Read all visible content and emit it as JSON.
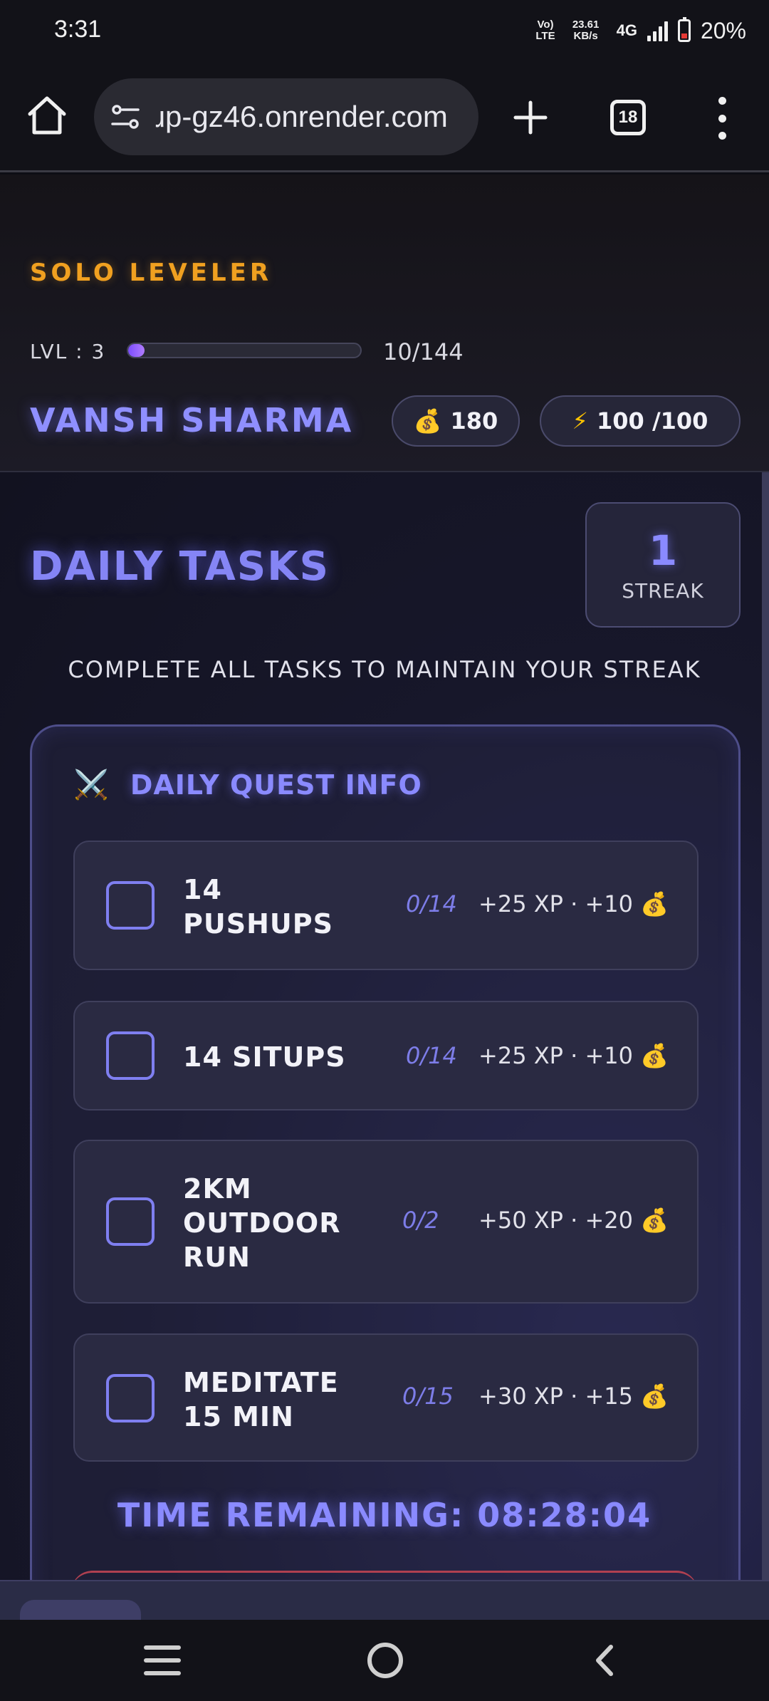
{
  "status_bar": {
    "time": "3:31",
    "volte": "Vo) LTE",
    "speed": "23.61 KB/s",
    "network": "4G",
    "battery": "20%"
  },
  "browser": {
    "url": "ɹp-gz46.onrender.com",
    "tab_count": "18"
  },
  "header": {
    "brand": "SOLO LEVELER",
    "level_label": "LVL : 3",
    "xp_text": "10/144",
    "xp_fraction": 0.07,
    "player_name": "VANSH SHARMA",
    "gold_icon": "💰",
    "gold": "180",
    "energy_icon": "⚡",
    "energy": "100 /100"
  },
  "daily": {
    "title": "DAILY TASKS",
    "streak_value": "1",
    "streak_label": "STREAK",
    "hint": "COMPLETE ALL TASKS TO MAINTAIN YOUR STREAK",
    "panel_icon": "⚔️",
    "panel_title": "DAILY QUEST INFO",
    "tasks": [
      {
        "name": "14 PUSHUPS",
        "progress": "0/14",
        "reward": "+25 XP · +10 💰"
      },
      {
        "name": "14 SITUPS",
        "progress": "0/14",
        "reward": "+25 XP · +10 💰"
      },
      {
        "name": "2KM OUTDOOR RUN",
        "progress": "0/2",
        "reward": "+50 XP · +20 💰"
      },
      {
        "name": "MEDITATE 15 MIN",
        "progress": "0/15",
        "reward": "+30 XP · +15 💰"
      }
    ],
    "timer": "TIME REMAINING: 08:28:04"
  },
  "colors": {
    "accent": "#8a8aff",
    "brand": "#f0a020",
    "background": "#17172a"
  }
}
